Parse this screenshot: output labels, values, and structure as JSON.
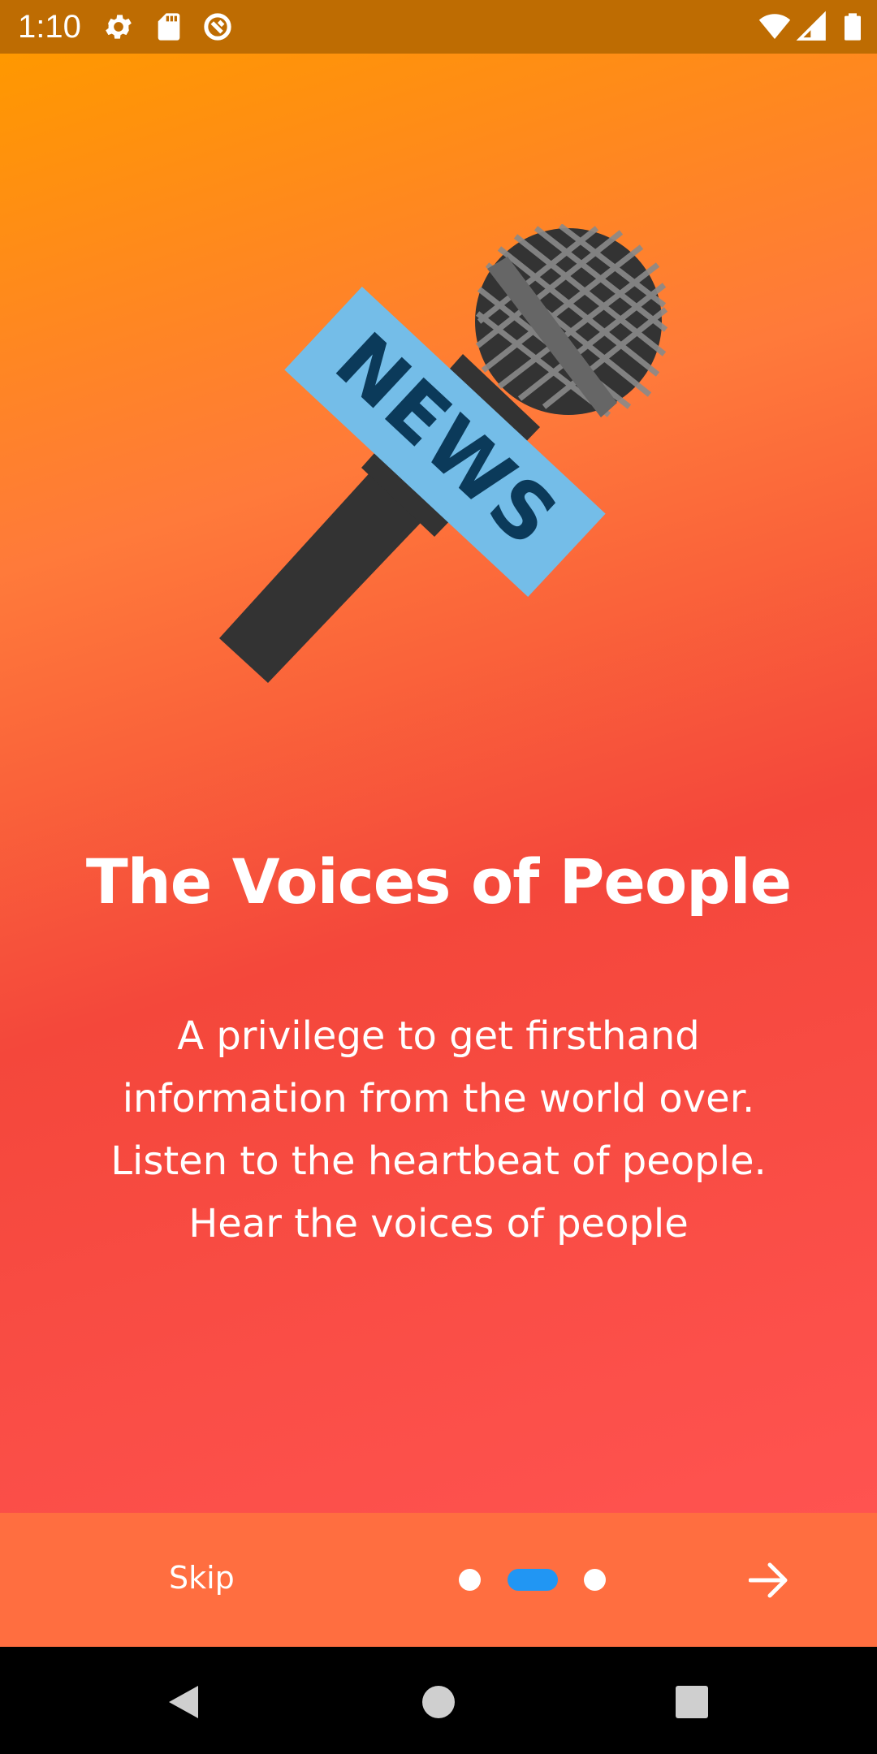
{
  "status_bar": {
    "time": "1:10",
    "icons": [
      "settings-icon",
      "sd-card-icon",
      "sync-icon",
      "wifi-icon",
      "signal-icon",
      "battery-icon"
    ]
  },
  "onboarding": {
    "illustration_text": "NEWS",
    "title": "The Voices of People",
    "description_lines": [
      "A privilege to get firsthand",
      "information from the world over.",
      "Listen to the heartbeat of people.",
      "Hear the voices of people"
    ],
    "skip_label": "Skip",
    "page_indicator": {
      "total": 3,
      "current": 2
    }
  },
  "nav_bar": {
    "buttons": [
      "back-icon",
      "home-icon",
      "recents-icon"
    ]
  },
  "colors": {
    "status_bar": "#BE6C02",
    "gradient_top": "#FF9800",
    "gradient_bottom": "#FF5350",
    "bottom_bar": "#FF6E40",
    "indicator_active": "#2196F3",
    "mic_body": "#333333",
    "news_banner": "#74BDE8",
    "news_text": "#0B3A5A"
  }
}
